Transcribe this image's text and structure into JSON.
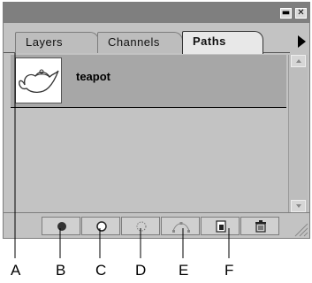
{
  "panel": {
    "tabs": [
      {
        "label": "Layers"
      },
      {
        "label": "Channels"
      },
      {
        "label": "Paths"
      }
    ],
    "active_tab": "Paths",
    "paths": [
      {
        "name": "teapot"
      }
    ],
    "bottom_buttons": [
      {
        "name": "fill-path-button",
        "icon": "filled-circle-icon"
      },
      {
        "name": "stroke-path-button",
        "icon": "outline-circle-icon"
      },
      {
        "name": "load-selection-button",
        "icon": "dotted-circle-icon"
      },
      {
        "name": "make-work-path-button",
        "icon": "anchor-path-icon"
      },
      {
        "name": "new-path-button",
        "icon": "new-page-icon"
      },
      {
        "name": "delete-path-button",
        "icon": "trash-icon"
      }
    ]
  },
  "callouts": [
    "A",
    "B",
    "C",
    "D",
    "E",
    "F"
  ]
}
